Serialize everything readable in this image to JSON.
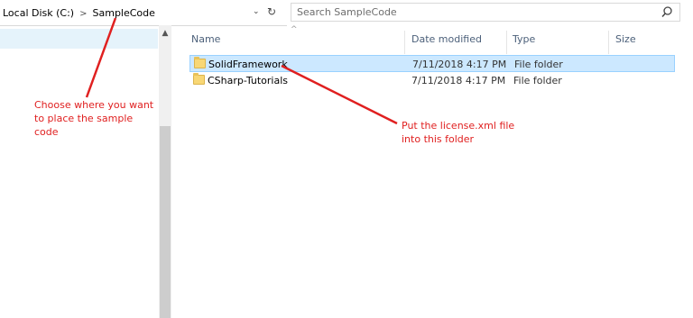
{
  "address_bar": {
    "breadcrumb": [
      "Local Disk (C:)",
      "SampleCode"
    ],
    "separator": ">",
    "dropdown_glyph": "⌄",
    "refresh_glyph": "↻"
  },
  "search": {
    "placeholder": "Search SampleCode",
    "icon": "search-icon"
  },
  "columns": {
    "name": "Name",
    "date": "Date modified",
    "type": "Type",
    "size": "Size",
    "sort_glyph": "^"
  },
  "files": [
    {
      "name": "SolidFramework",
      "date": "7/11/2018 4:17 PM",
      "type": "File folder",
      "size": "",
      "selected": true,
      "icon": "folder-icon"
    },
    {
      "name": "CSharp-Tutorials",
      "date": "7/11/2018 4:17 PM",
      "type": "File folder",
      "size": "",
      "selected": false,
      "icon": "folder-icon"
    }
  ],
  "annotations": {
    "left_note": [
      "Choose where you want",
      "to place the sample",
      "code"
    ],
    "right_note": [
      "Put the license.xml file",
      "into this folder"
    ],
    "color": "#e02020"
  },
  "colors": {
    "selection_bg": "#cce8ff",
    "selection_border": "#99d1ff",
    "nav_selection": "#e5f3fb",
    "header_text": "#4c607a"
  }
}
